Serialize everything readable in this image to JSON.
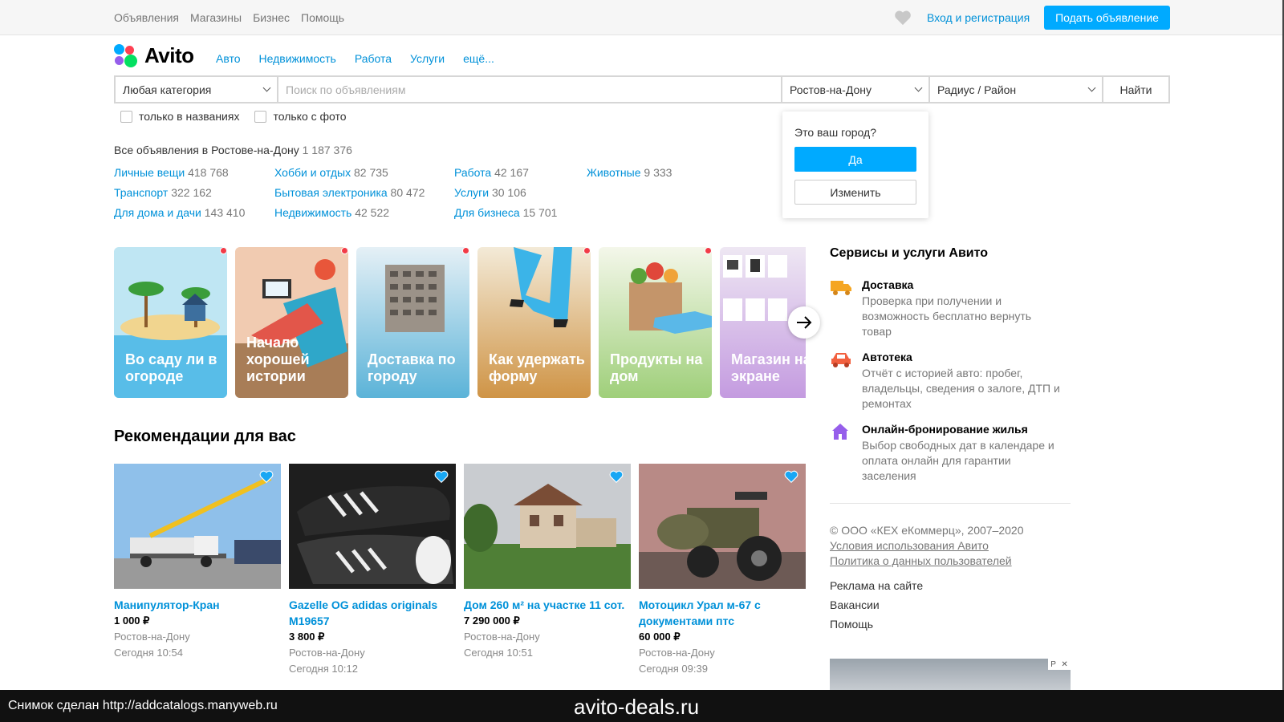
{
  "topbar": {
    "nav": [
      "Объявления",
      "Магазины",
      "Бизнес",
      "Помощь"
    ],
    "login": "Вход и регистрация",
    "post_button": "Подать объявление"
  },
  "logo": {
    "text": "Avito"
  },
  "mainnav": [
    "Авто",
    "Недвижимость",
    "Работа",
    "Услуги",
    "ещё..."
  ],
  "search": {
    "category": "Любая категория",
    "placeholder": "Поиск по объявлениям",
    "city": "Ростов-на-Дону",
    "radius": "Радиус / Район",
    "find": "Найти",
    "only_titles": "только в названиях",
    "only_photo": "только с фото"
  },
  "city_popup": {
    "question": "Это ваш город?",
    "yes": "Да",
    "change": "Изменить"
  },
  "all_ads": {
    "label": "Все объявления в Ростове-на-Дону",
    "count": "1 187 376"
  },
  "categories": [
    [
      {
        "name": "Личные вещи",
        "count": "418 768"
      },
      {
        "name": "Транспорт",
        "count": "322 162"
      },
      {
        "name": "Для дома и дачи",
        "count": "143 410"
      }
    ],
    [
      {
        "name": "Хобби и отдых",
        "count": "82 735"
      },
      {
        "name": "Бытовая электроника",
        "count": "80 472"
      },
      {
        "name": "Недвижимость",
        "count": "42 522"
      }
    ],
    [
      {
        "name": "Работа",
        "count": "42 167"
      },
      {
        "name": "Услуги",
        "count": "30 106"
      },
      {
        "name": "Для бизнеса",
        "count": "15 701"
      }
    ],
    [
      {
        "name": "Животные",
        "count": "9 333"
      }
    ]
  ],
  "stories": [
    {
      "title": "Во саду ли в огороде"
    },
    {
      "title": "Начало хорошей истории"
    },
    {
      "title": "Доставка по городу"
    },
    {
      "title": "Как удержать форму"
    },
    {
      "title": "Продукты на дом"
    },
    {
      "title": "Магазин на экране"
    }
  ],
  "recommendations": {
    "title": "Рекомендации для вас",
    "items": [
      {
        "title": "Манипулятор-Кран",
        "price": "1 000 ₽",
        "city": "Ростов-на-Дону",
        "time": "Сегодня 10:54"
      },
      {
        "title": "Gazelle OG adidas originals M19657",
        "price": "3 800 ₽",
        "city": "Ростов-на-Дону",
        "time": "Сегодня 10:12"
      },
      {
        "title": "Дом 260 м² на участке 11 сот.",
        "price": "7 290 000 ₽",
        "city": "Ростов-на-Дону",
        "time": "Сегодня 10:51"
      },
      {
        "title": "Мотоцикл Урал м-67 с документами птс",
        "price": "60 000 ₽",
        "city": "Ростов-на-Дону",
        "time": "Сегодня 09:39"
      }
    ]
  },
  "services": {
    "title": "Сервисы и услуги Авито",
    "items": [
      {
        "name": "Доставка",
        "desc": "Проверка при получении и возможность бесплатно вернуть товар",
        "icon": "truck-icon"
      },
      {
        "name": "Автотека",
        "desc": "Отчёт с историей авто: пробег, владельцы, сведения о залоге, ДТП и ремонтах",
        "icon": "car-icon"
      },
      {
        "name": "Онлайн-бронирование жилья",
        "desc": "Выбор свободных дат в календаре и оплата онлайн для гарантии заселения",
        "icon": "house-icon"
      }
    ]
  },
  "footer": {
    "copyright": "© ООО «КЕХ еКоммерц», 2007–2020",
    "terms": "Условия использования Авито",
    "privacy": "Политика о данных пользователей",
    "ads": "Реклама на сайте",
    "jobs": "Вакансии",
    "help": "Помощь"
  },
  "bottom_strip": {
    "left": "Снимок сделан http://addcatalogs.manyweb.ru",
    "center": "avito-deals.ru"
  },
  "colors": {
    "accent": "#00aaff",
    "link": "#0091d9",
    "badge": "#f23b47"
  }
}
